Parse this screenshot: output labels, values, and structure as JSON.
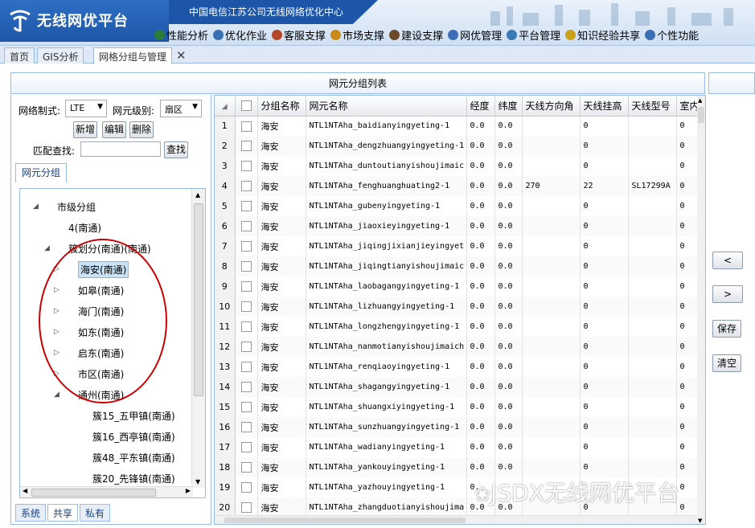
{
  "app": {
    "title": "无线网优平台",
    "banner": "中国电信江苏公司无线网络优化中心"
  },
  "menu": [
    {
      "label": "性能分析",
      "icon": "globe-icon",
      "color": "#2a7a3a"
    },
    {
      "label": "优化作业",
      "icon": "gear-globe-icon",
      "color": "#3a6fb5"
    },
    {
      "label": "客服支撑",
      "icon": "person-icon",
      "color": "#b5452a"
    },
    {
      "label": "市场支撑",
      "icon": "chart-icon",
      "color": "#c98a1a"
    },
    {
      "label": "建设支撑",
      "icon": "tools-icon",
      "color": "#6b4a2a"
    },
    {
      "label": "网优管理",
      "icon": "network-icon",
      "color": "#3a6fb5"
    },
    {
      "label": "平台管理",
      "icon": "monitor-icon",
      "color": "#3a7ab5"
    },
    {
      "label": "知识经验共享",
      "icon": "book-icon",
      "color": "#c9a21a"
    },
    {
      "label": "个性功能",
      "icon": "globe-user-icon",
      "color": "#3a6fb5"
    }
  ],
  "tabs": [
    {
      "label": "首页"
    },
    {
      "label": "GIS分析"
    },
    {
      "label": "网格分组与管理"
    }
  ],
  "panel_title": "网元分组列表",
  "filters": {
    "network_label": "网络制式:",
    "network_value": "LTE",
    "level_label": "网元级别:",
    "level_value": "扇区",
    "add_label": "新增",
    "edit_label": "编辑",
    "delete_label": "删除",
    "match_label": "匹配查找:",
    "search_label": "查找"
  },
  "subtab": "网元分组",
  "tree": [
    {
      "label": "市级分组",
      "level": 0,
      "state": "expanded"
    },
    {
      "label": "4(南通)",
      "level": 1,
      "state": "leaf"
    },
    {
      "label": "簇划分(南通)(南通)",
      "level": 1,
      "state": "expanded"
    },
    {
      "label": "海安(南通)",
      "level": 2,
      "state": "collapsed",
      "selected": true
    },
    {
      "label": "如皋(南通)",
      "level": 2,
      "state": "collapsed"
    },
    {
      "label": "海门(南通)",
      "level": 2,
      "state": "collapsed"
    },
    {
      "label": "如东(南通)",
      "level": 2,
      "state": "collapsed"
    },
    {
      "label": "启东(南通)",
      "level": 2,
      "state": "collapsed"
    },
    {
      "label": "市区(南通)",
      "level": 2,
      "state": "collapsed"
    },
    {
      "label": "通州(南通)",
      "level": 2,
      "state": "expanded"
    },
    {
      "label": "簇15_五甲镇(南通)",
      "level": 3,
      "state": "leaf"
    },
    {
      "label": "簇16_西亭镇(南通)",
      "level": 3,
      "state": "leaf"
    },
    {
      "label": "簇48_平东镇(南通)",
      "level": 3,
      "state": "leaf"
    },
    {
      "label": "簇20_先锋镇(南通)",
      "level": 3,
      "state": "leaf"
    }
  ],
  "bottom_tabs": [
    "系统",
    "共享",
    "私有"
  ],
  "grid": {
    "columns": [
      "分组名称",
      "网元名称",
      "经度",
      "纬度",
      "天线方向角",
      "天线挂高",
      "天线型号",
      "室内"
    ],
    "rows": [
      {
        "n": "1",
        "group": "海安",
        "name": "NTL1NTAha_baidianyingyeting-1",
        "lng": "0.0",
        "lat": "0.0",
        "az": "",
        "h": "0",
        "model": "",
        "indoor": "0"
      },
      {
        "n": "2",
        "group": "海安",
        "name": "NTL1NTAha_dengzhuangyingyeting-1",
        "lng": "0.0",
        "lat": "0.0",
        "az": "",
        "h": "0",
        "model": "",
        "indoor": "0"
      },
      {
        "n": "3",
        "group": "海安",
        "name": "NTL1NTAha_duntoutianyishoujimaic",
        "lng": "0.0",
        "lat": "0.0",
        "az": "",
        "h": "0",
        "model": "",
        "indoor": "0"
      },
      {
        "n": "4",
        "group": "海安",
        "name": "NTL1NTAha_fenghuanghuating2-1",
        "lng": "0.0",
        "lat": "0.0",
        "az": "270",
        "h": "22",
        "model": "SL17299A",
        "indoor": "0"
      },
      {
        "n": "5",
        "group": "海安",
        "name": "NTL1NTAha_gubenyingyeting-1",
        "lng": "0.0",
        "lat": "0.0",
        "az": "",
        "h": "0",
        "model": "",
        "indoor": "0"
      },
      {
        "n": "6",
        "group": "海安",
        "name": "NTL1NTAha_jiaoxieyingyeting-1",
        "lng": "0.0",
        "lat": "0.0",
        "az": "",
        "h": "0",
        "model": "",
        "indoor": "0"
      },
      {
        "n": "7",
        "group": "海安",
        "name": "NTL1NTAha_jiqingjixianjieyingyet",
        "lng": "0.0",
        "lat": "0.0",
        "az": "",
        "h": "0",
        "model": "",
        "indoor": "0"
      },
      {
        "n": "8",
        "group": "海安",
        "name": "NTL1NTAha_jiqingtianyishoujimaic",
        "lng": "0.0",
        "lat": "0.0",
        "az": "",
        "h": "0",
        "model": "",
        "indoor": "0"
      },
      {
        "n": "9",
        "group": "海安",
        "name": "NTL1NTAha_laobagangyingyeting-1",
        "lng": "0.0",
        "lat": "0.0",
        "az": "",
        "h": "0",
        "model": "",
        "indoor": "0"
      },
      {
        "n": "10",
        "group": "海安",
        "name": "NTL1NTAha_lizhuangyingyeting-1",
        "lng": "0.0",
        "lat": "0.0",
        "az": "",
        "h": "0",
        "model": "",
        "indoor": "0"
      },
      {
        "n": "11",
        "group": "海安",
        "name": "NTL1NTAha_longzhengyingyeting-1",
        "lng": "0.0",
        "lat": "0.0",
        "az": "",
        "h": "0",
        "model": "",
        "indoor": "0"
      },
      {
        "n": "12",
        "group": "海安",
        "name": "NTL1NTAha_nanmotianyishoujimaich",
        "lng": "0.0",
        "lat": "0.0",
        "az": "",
        "h": "0",
        "model": "",
        "indoor": "0"
      },
      {
        "n": "13",
        "group": "海安",
        "name": "NTL1NTAha_renqiaoyingyeting-1",
        "lng": "0.0",
        "lat": "0.0",
        "az": "",
        "h": "0",
        "model": "",
        "indoor": "0"
      },
      {
        "n": "14",
        "group": "海安",
        "name": "NTL1NTAha_shagangyingyeting-1",
        "lng": "0.0",
        "lat": "0.0",
        "az": "",
        "h": "0",
        "model": "",
        "indoor": "0"
      },
      {
        "n": "15",
        "group": "海安",
        "name": "NTL1NTAha_shuangxiyingyeting-1",
        "lng": "0.0",
        "lat": "0.0",
        "az": "",
        "h": "0",
        "model": "",
        "indoor": "0"
      },
      {
        "n": "16",
        "group": "海安",
        "name": "NTL1NTAha_sunzhuangyingyeting-1",
        "lng": "0.0",
        "lat": "0.0",
        "az": "",
        "h": "0",
        "model": "",
        "indoor": "0"
      },
      {
        "n": "17",
        "group": "海安",
        "name": "NTL1NTAha_wadianyingyeting-1",
        "lng": "0.0",
        "lat": "0.0",
        "az": "",
        "h": "0",
        "model": "",
        "indoor": "0"
      },
      {
        "n": "18",
        "group": "海安",
        "name": "NTL1NTAha_yankouyingyeting-1",
        "lng": "0.0",
        "lat": "0.0",
        "az": "",
        "h": "0",
        "model": "",
        "indoor": "0"
      },
      {
        "n": "19",
        "group": "海安",
        "name": "NTL1NTAha_yazhouyingyeting-1",
        "lng": "0.",
        "lat": "",
        "az": "",
        "h": "",
        "model": "",
        "indoor": "0"
      },
      {
        "n": "20",
        "group": "海安",
        "name": "NTL1NTAha_zhangduotianyishoujima",
        "lng": "0.0",
        "lat": "0.0",
        "az": "",
        "h": "0",
        "model": "",
        "indoor": "0"
      }
    ]
  },
  "right_buttons": {
    "left_arrow": "<",
    "right_arrow": ">",
    "save": "保存",
    "clear": "清空"
  },
  "watermark": "JSDX无线网优平台"
}
